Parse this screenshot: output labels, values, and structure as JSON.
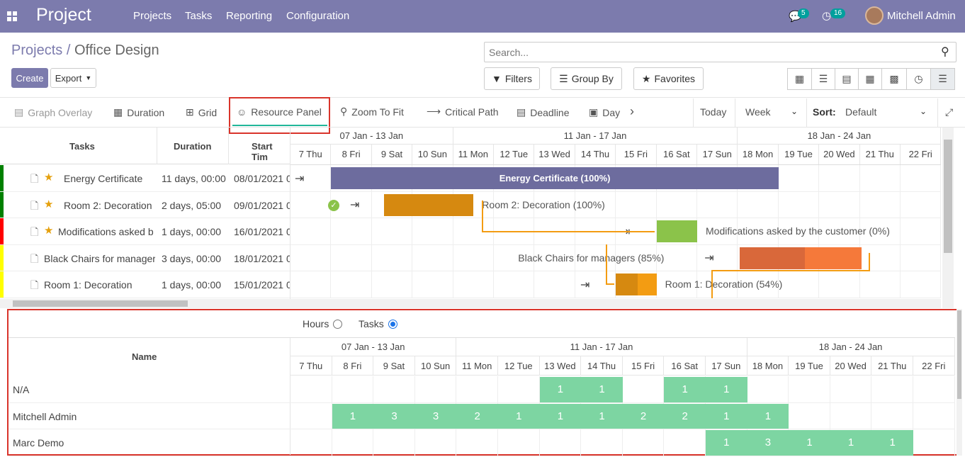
{
  "navbar": {
    "brand": "Project",
    "menu": [
      "Projects",
      "Tasks",
      "Reporting",
      "Configuration"
    ],
    "chat_count": "5",
    "activity_count": "16",
    "user": "Mitchell Admin"
  },
  "breadcrumb": {
    "parent": "Projects",
    "separator": "/",
    "current": "Office Design"
  },
  "buttons": {
    "create": "Create",
    "export": "Export"
  },
  "search": {
    "placeholder": "Search..."
  },
  "filters": {
    "filters": "Filters",
    "group_by": "Group By",
    "favorites": "Favorites"
  },
  "toolbar": {
    "graph_overlay": "Graph Overlay",
    "duration": "Duration",
    "grid": "Grid",
    "resource_panel": "Resource Panel",
    "zoom_to_fit": "Zoom To Fit",
    "critical_path": "Critical Path",
    "deadline": "Deadline",
    "day": "Day",
    "today": "Today",
    "week": "Week",
    "sort_label": "Sort:",
    "sort_value": "Default"
  },
  "gantt": {
    "columns": {
      "tasks": "Tasks",
      "duration": "Duration",
      "start": "Start Tim"
    },
    "week_ranges": [
      "07 Jan - 13 Jan",
      "11 Jan - 17 Jan",
      "18 Jan - 24 Jan"
    ],
    "days": [
      "7 Thu",
      "8 Fri",
      "9 Sat",
      "10 Sun",
      "11 Mon",
      "12 Tue",
      "13 Wed",
      "14 Thu",
      "15 Fri",
      "16 Sat",
      "17 Sun",
      "18 Mon",
      "19 Tue",
      "20 Wed",
      "21 Thu",
      "22 Fri"
    ],
    "tasks": [
      {
        "name": "Energy Certificate",
        "duration": "11 days, 00:00",
        "start": "08/01/2021 0",
        "starred": true,
        "color": "#008000"
      },
      {
        "name": "Room 2: Decoration",
        "duration": "2 days, 05:00",
        "start": "09/01/2021 0",
        "starred": true,
        "color": "#008000"
      },
      {
        "name": "Modifications asked b",
        "duration": "1 days, 00:00",
        "start": "16/01/2021 0",
        "starred": true,
        "color": "#ff0000"
      },
      {
        "name": "Black Chairs for manager",
        "duration": "3 days, 00:00",
        "start": "18/01/2021 0",
        "starred": false,
        "color": "#ffff00"
      },
      {
        "name": "Room 1: Decoration",
        "duration": "1 days, 00:00",
        "start": "15/01/2021 0",
        "starred": false,
        "color": "#ffff00"
      }
    ],
    "bar_labels": [
      "Energy Certificate (100%)",
      "Room 2: Decoration (100%)",
      "Modifications asked by the customer (0%)",
      "Black Chairs for managers (85%)",
      "Room 1: Decoration (54%)"
    ]
  },
  "resource": {
    "hours": "Hours",
    "tasks": "Tasks",
    "selected": "Tasks",
    "name_header": "Name",
    "week_ranges": [
      "07 Jan - 13 Jan",
      "11 Jan - 17 Jan",
      "18 Jan - 24 Jan"
    ],
    "days": [
      "7 Thu",
      "8 Fri",
      "9 Sat",
      "10 Sun",
      "11 Mon",
      "12 Tue",
      "13 Wed",
      "14 Thu",
      "15 Fri",
      "16 Sat",
      "17 Sun",
      "18 Mon",
      "19 Tue",
      "20 Wed",
      "21 Thu",
      "22 Fri"
    ],
    "rows": [
      {
        "name": "N/A",
        "cells": [
          null,
          null,
          null,
          null,
          null,
          null,
          "1",
          "1",
          null,
          "1",
          "1",
          null,
          null,
          null,
          null,
          null
        ]
      },
      {
        "name": "Mitchell Admin",
        "cells": [
          null,
          "1",
          "3",
          "3",
          "2",
          "1",
          "1",
          "1",
          "2",
          "2",
          "1",
          "1",
          null,
          null,
          null,
          null
        ]
      },
      {
        "name": "Marc Demo",
        "cells": [
          null,
          null,
          null,
          null,
          null,
          null,
          null,
          null,
          null,
          null,
          "1",
          "3",
          "1",
          "1",
          "1",
          null
        ]
      }
    ]
  }
}
